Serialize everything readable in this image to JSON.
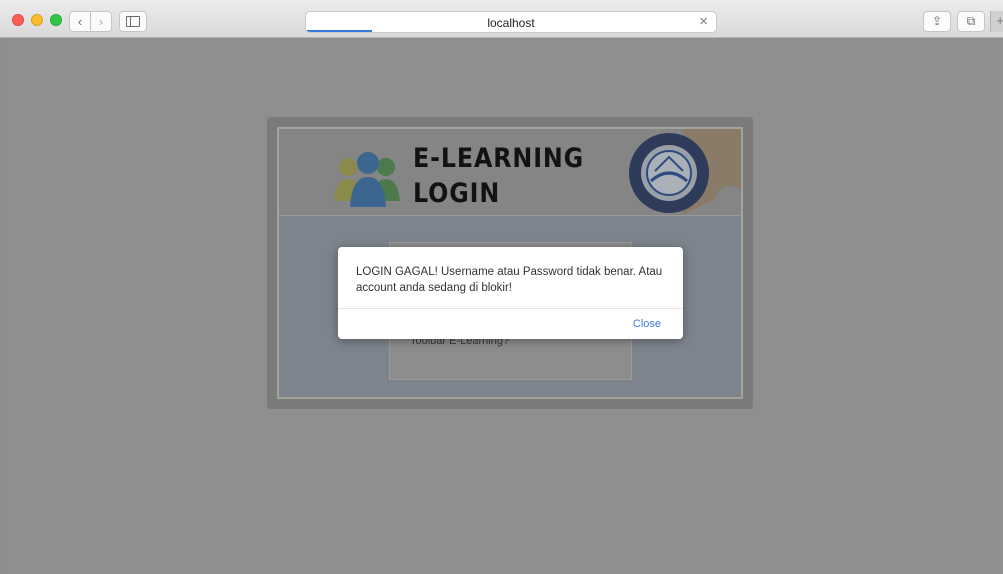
{
  "browser": {
    "url_text": "localhost",
    "load_progress": 0.16,
    "back_glyph": "‹",
    "forward_glyph": "›",
    "close_glyph": "×",
    "share_glyph": "⇪",
    "tabs_glyph": "⧉",
    "new_tab_glyph": "+"
  },
  "page": {
    "title_line1": "E-LEARNING",
    "title_line2": "LOGIN",
    "login_caption": "Toolbar E-Learning?"
  },
  "modal": {
    "message": "LOGIN GAGAL! Username atau Password tidak benar. Atau account anda sedang di blokir!",
    "close_label": "Close"
  },
  "colors": {
    "overlay_bg": "#8f8f8f",
    "modal_bg": "#ffffff",
    "close_link": "#3b79d6",
    "progress": "#3677e1"
  }
}
